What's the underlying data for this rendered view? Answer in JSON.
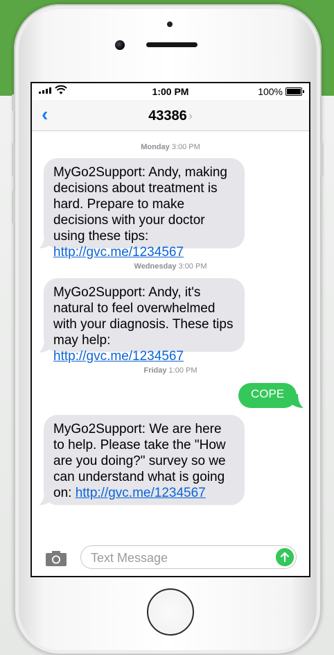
{
  "status_bar": {
    "time": "1:00 PM",
    "battery": "100%"
  },
  "nav": {
    "back_icon": "chevron-left-icon",
    "contact": "43386",
    "contact_chevron": "›"
  },
  "conversation": [
    {
      "type": "timestamp",
      "day": "Monday",
      "time": "3:00 PM"
    },
    {
      "type": "incoming",
      "text": "MyGo2Support: Andy, making decisions about treatment is hard. Prepare to make decisions with your doctor using these tips: ",
      "link": "http://gvc.me/1234567"
    },
    {
      "type": "timestamp",
      "day": "Wednesday",
      "time": "3:00 PM"
    },
    {
      "type": "incoming",
      "text": "MyGo2Support: Andy, it's natural to feel overwhelmed with your diagnosis. These tips may help: ",
      "link": "http://gvc.me/1234567"
    },
    {
      "type": "timestamp",
      "day": "Friday",
      "time": "1:00 PM"
    },
    {
      "type": "outgoing",
      "text": "COPE"
    },
    {
      "type": "incoming",
      "text": "MyGo2Support: We are here to help. Please take the \"How are you doing?\" survey so we can understand what is going on: ",
      "link": "http://gvc.me/1234567"
    }
  ],
  "composer": {
    "placeholder": "Text Message",
    "camera_icon": "camera-icon",
    "send_icon": "send-arrow-icon"
  },
  "colors": {
    "brand_green": "#5aa544",
    "imessage_green": "#34c759",
    "link_blue": "#0b64d8",
    "incoming_bubble": "#e5e5ea"
  }
}
